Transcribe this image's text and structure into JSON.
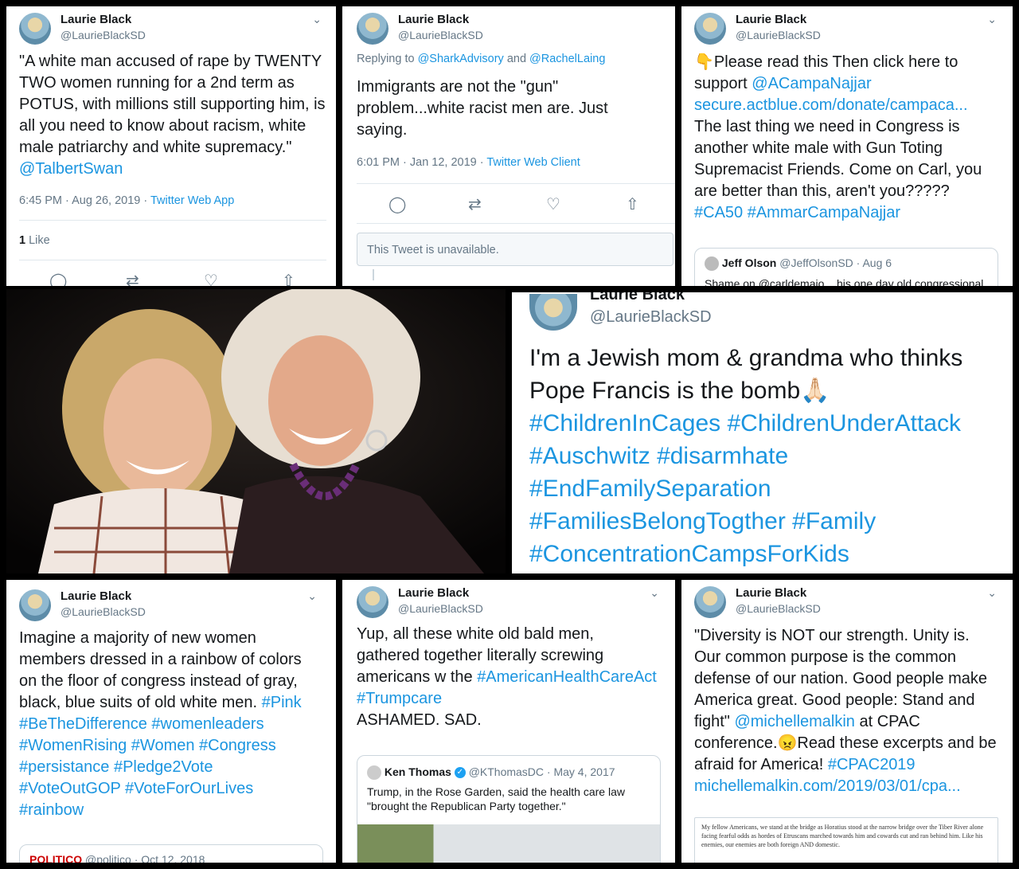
{
  "collage": {
    "t1": {
      "name": "Laurie Black",
      "handle": "@LaurieBlackSD",
      "text_a": "\"A white man accused of rape by TWENTY TWO women running for a 2nd term as POTUS, with millions still supporting him, is all you need to know about racism, white male patriarchy and white supremacy.\"",
      "mention": "@TalbertSwan",
      "time": "6:45 PM · Aug 26, 2019 ·",
      "client": "Twitter Web App",
      "likes_count": "1",
      "likes_label": "Like"
    },
    "t2": {
      "name": "Laurie Black",
      "handle": "@LaurieBlackSD",
      "replying": "Replying to",
      "reply_a": "@SharkAdvisory",
      "reply_and": "and",
      "reply_b": "@RachelLaing",
      "text": "Immigrants are not the \"gun\" problem...white racist men are. Just saying.",
      "time": "6:01 PM · Jan 12, 2019 ·",
      "client": "Twitter Web Client",
      "unavailable": "This Tweet is unavailable."
    },
    "t3": {
      "name": "Laurie Black",
      "handle": "@LaurieBlackSD",
      "emoji": "👇",
      "lead": "Please read this Then click here to support",
      "mention": "@ACampaNajjar",
      "link": "secure.actblue.com/donate/campaca...",
      "text": "The last thing we need in Congress is another white male with Gun Toting Supremacist Friends. Come on Carl, you are better than this, aren't you?????",
      "tags": "#CA50 #AmmarCampaNajjar",
      "quote_name": "Jeff Olson",
      "quote_handle": "@JeffOlsonSD · Aug 6",
      "quote_text": "Shame on @carldemaio... his one day old congressional"
    },
    "t4": {
      "name": "Laurie Black",
      "handle": "@LaurieBlackSD",
      "text": "I'm a Jewish mom & grandma who thinks Pope Francis is the bomb",
      "emoji": "🙏🏻",
      "tags": "#ChildrenInCages #ChildrenUnderAttack #Auschwitz #disarmhate #EndFamilySeparation #FamiliesBelongTogther #Family #ConcentrationCampsForKids"
    },
    "t5": {
      "name": "Laurie Black",
      "handle": "@LaurieBlackSD",
      "text": "Imagine a majority of new women members dressed in a rainbow of colors on the floor of congress instead of gray, black, blue suits of old white men.",
      "tags": "#Pink #BeTheDifference #womenleaders #WomenRising #Women #Congress #persistance #Pledge2Vote #VoteOutGOP #VoteForOurLives #rainbow",
      "quote_name": "POLITICO",
      "quote_handle": "@politico · Oct 12, 2018"
    },
    "t6": {
      "name": "Laurie Black",
      "handle": "@LaurieBlackSD",
      "text": "Yup, all these white old bald men, gathered together literally screwing americans w the",
      "tags": "#AmericanHealthCareAct #Trumpcare",
      "tail": "ASHAMED. SAD.",
      "quote_name": "Ken Thomas",
      "quote_handle": "@KThomasDC · May 4, 2017",
      "quote_text": "Trump, in the Rose Garden, said the health care law \"brought the Republican Party together.\""
    },
    "t7": {
      "name": "Laurie Black",
      "handle": "@LaurieBlackSD",
      "text_a": "\"Diversity is NOT our strength. Unity is. Our common purpose is the common defense of our nation. Good people make America great. Good people: Stand and fight\"",
      "mention": "@michellemalkin",
      "text_b": "at CPAC conference.",
      "emoji": "😠",
      "text_c": "Read these excerpts and be afraid for America!",
      "tag": "#CPAC2019",
      "link": "michellemalkin.com/2019/03/01/cpa...",
      "excerpt": "My fellow Americans, we stand at the bridge as Horatius stood at the narrow bridge over the Tiber River alone facing fearful odds as hordes of Etruscans marched towards him and cowards cut and ran behind him. Like his enemies, our enemies are both foreign AND domestic."
    }
  }
}
